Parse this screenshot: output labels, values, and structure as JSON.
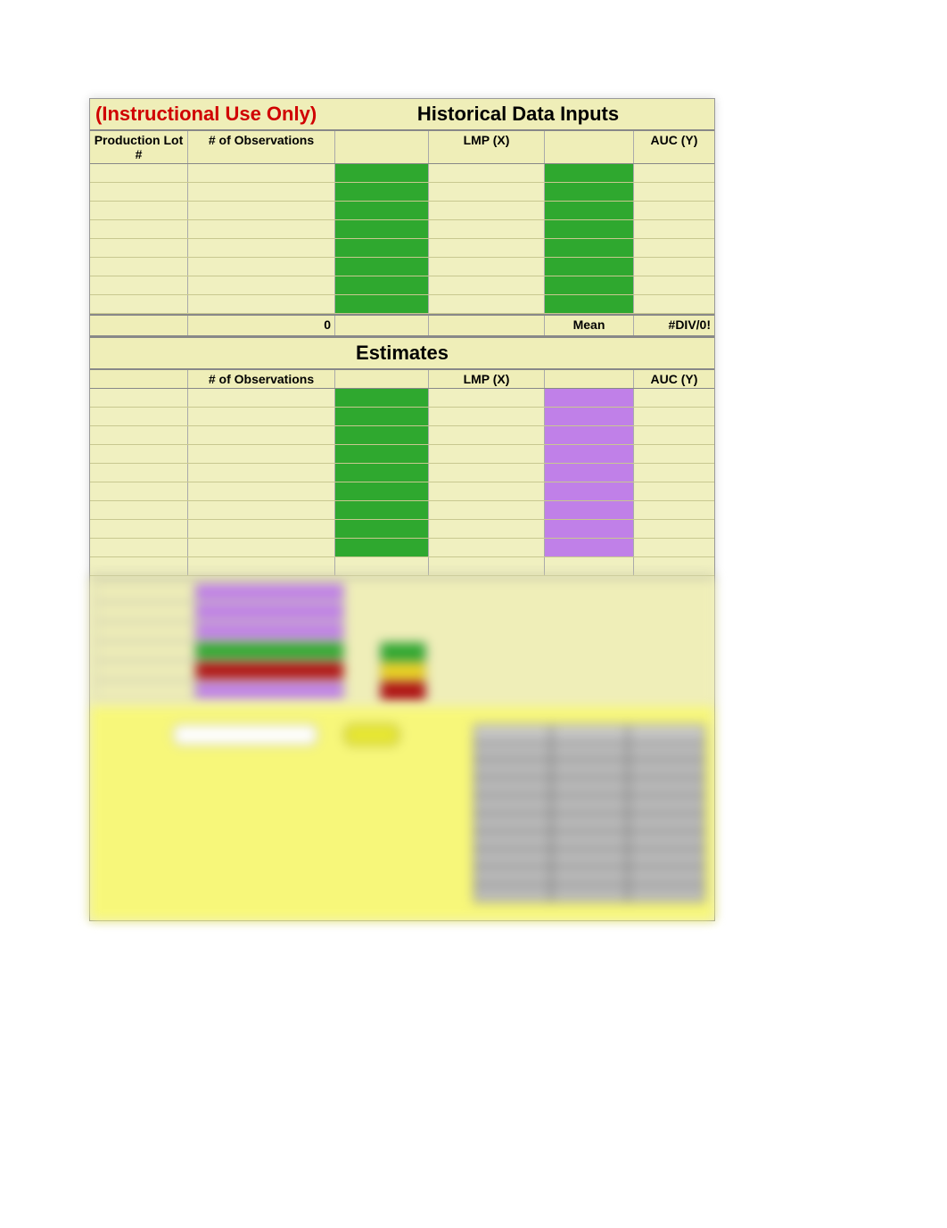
{
  "header": {
    "instructional": "(Instructional Use Only)",
    "title": "Historical Data Inputs"
  },
  "columns": {
    "prod_lot": "Production Lot #",
    "observations": "# of Observations",
    "lmp": "LMP (X)",
    "auc": "AUC (Y)"
  },
  "historical": {
    "footer": {
      "total_obs": "0",
      "mean_label": "Mean",
      "mean_value": "#DIV/0!"
    }
  },
  "estimates": {
    "title": "Estimates",
    "columns": {
      "observations": "# of Observations",
      "lmp": "LMP (X)",
      "auc": "AUC (Y)"
    }
  }
}
